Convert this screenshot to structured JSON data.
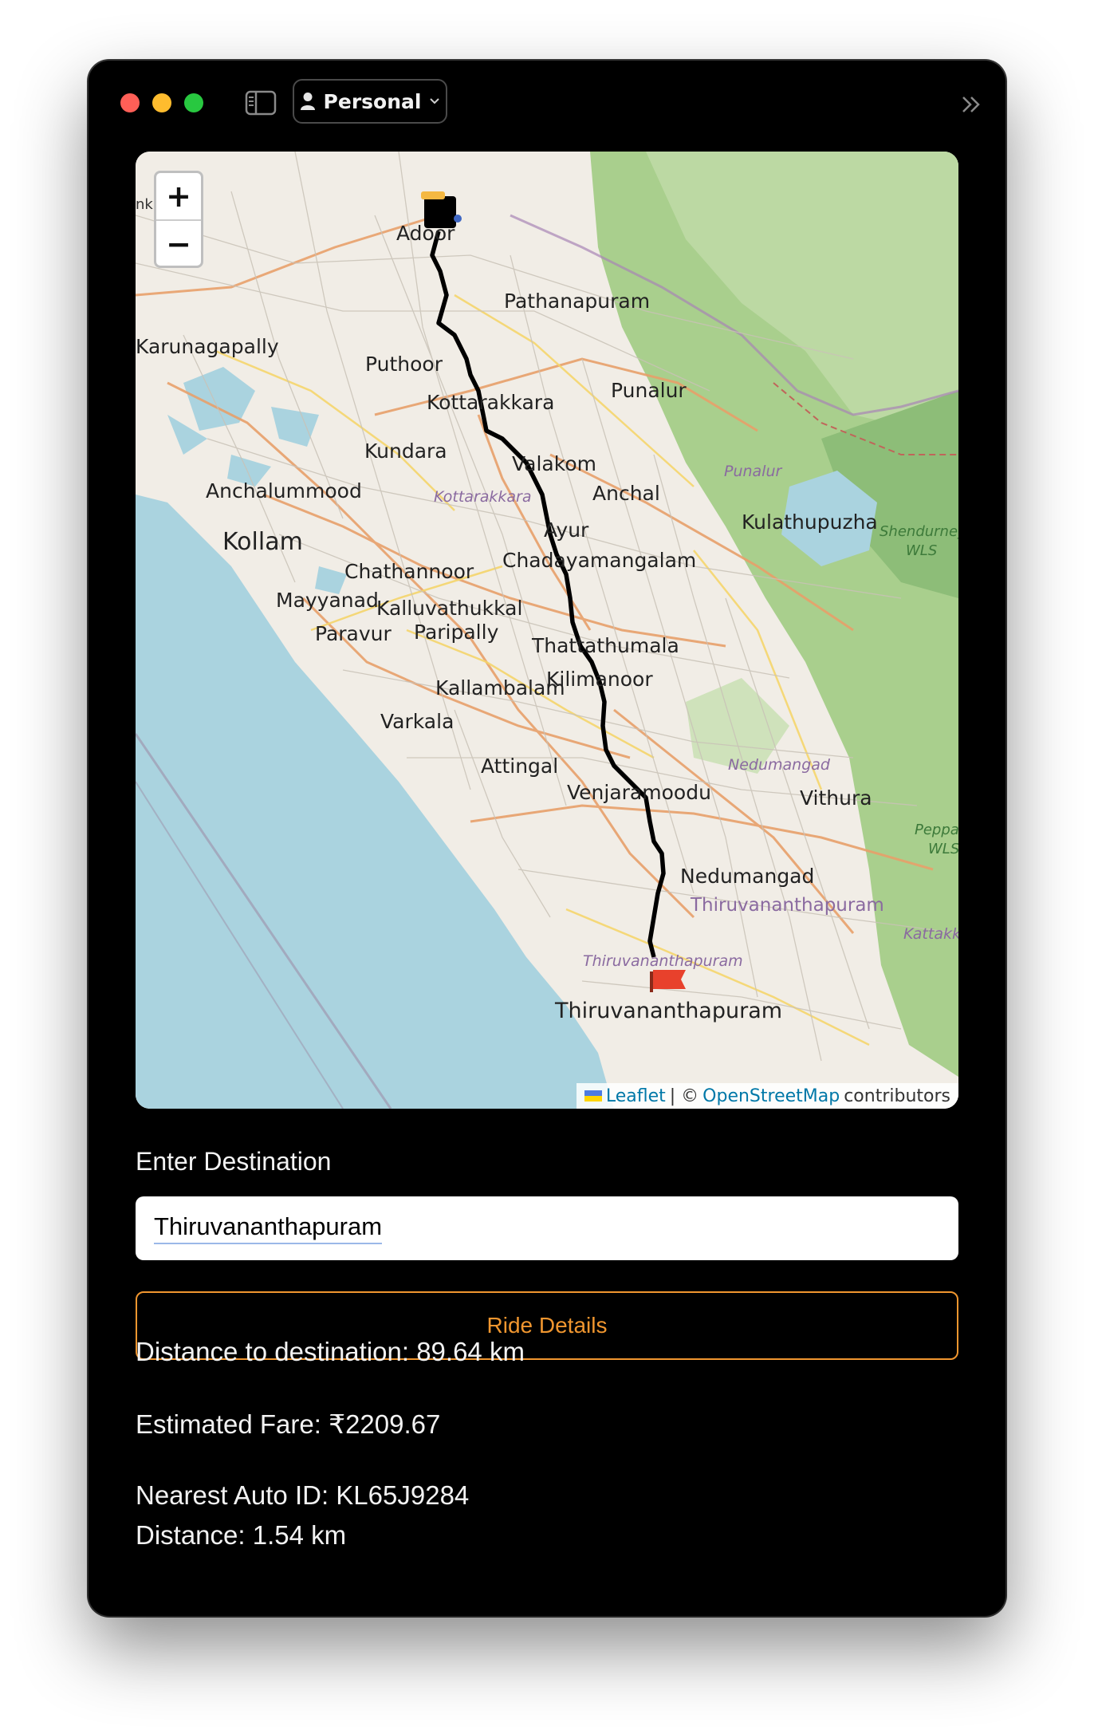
{
  "window": {
    "profile_label": "Personal"
  },
  "map": {
    "zoom_in": "+",
    "zoom_out": "−",
    "places": {
      "adoor": "Adoor",
      "pathanapuram": "Pathanapuram",
      "karunagapally": "Karunagapally",
      "puthoor": "Puthoor",
      "punalur": "Punalur",
      "kottarakkara": "Kottarakkara",
      "kundara": "Kundara",
      "valakom": "Valakom",
      "punalur_district": "Punalur",
      "anchalummood": "Anchalummood",
      "anchal": "Anchal",
      "kottarakkara_district": "Kottarakkara",
      "kulathupuzha": "Kulathupuzha",
      "kollam": "Kollam",
      "ayur": "Ayur",
      "shendurney": "Shendurney",
      "wls": "WLS",
      "chadayamangalam": "Chadayamangalam",
      "chathannoor": "Chathannoor",
      "mayyanad": "Mayyanad",
      "kalluvathukkal": "Kalluvathukkal",
      "paravur": "Paravur",
      "paripally": "Paripally",
      "thattathumala": "Thattathumala",
      "kilimanoor": "Kilimanoor",
      "kallambalam": "Kallambalam",
      "varkala": "Varkala",
      "nedumangad_district": "Nedumangad",
      "attingal": "Attingal",
      "venjaramoodu": "Venjaramoodu",
      "vithura": "Vithura",
      "peppara": "Peppa",
      "peppara_wls": "WLS",
      "nedumangad": "Nedumangad",
      "thiruvananthapuram_district_big": "Thiruvananthapuram",
      "kattakkada": "Kattakk",
      "thiruvananthapuram_district": "Thiruvananthapuram",
      "thiruvananthapuram_city": "Thiruvananthapuram"
    },
    "attribution": {
      "leaflet": "Leaflet",
      "separator": "| ©",
      "osm": "OpenStreetMap",
      "contributors": "contributors"
    },
    "colors": {
      "sea": "#aad3df",
      "forest": "#a9cf8d",
      "route": "#000000",
      "destination_flag": "#e8412c"
    }
  },
  "form": {
    "destination_label": "Enter Destination",
    "destination_value": "Thiruvananthapuram",
    "ride_button": "Ride Details"
  },
  "results": {
    "distance": "Distance to destination: 89.64 km",
    "fare": "Estimated Fare: ₹2209.67",
    "nearest_auto": "Nearest Auto ID: KL65J9284",
    "auto_distance": "Distance: 1.54 km"
  },
  "accent_color": "#f0962f"
}
